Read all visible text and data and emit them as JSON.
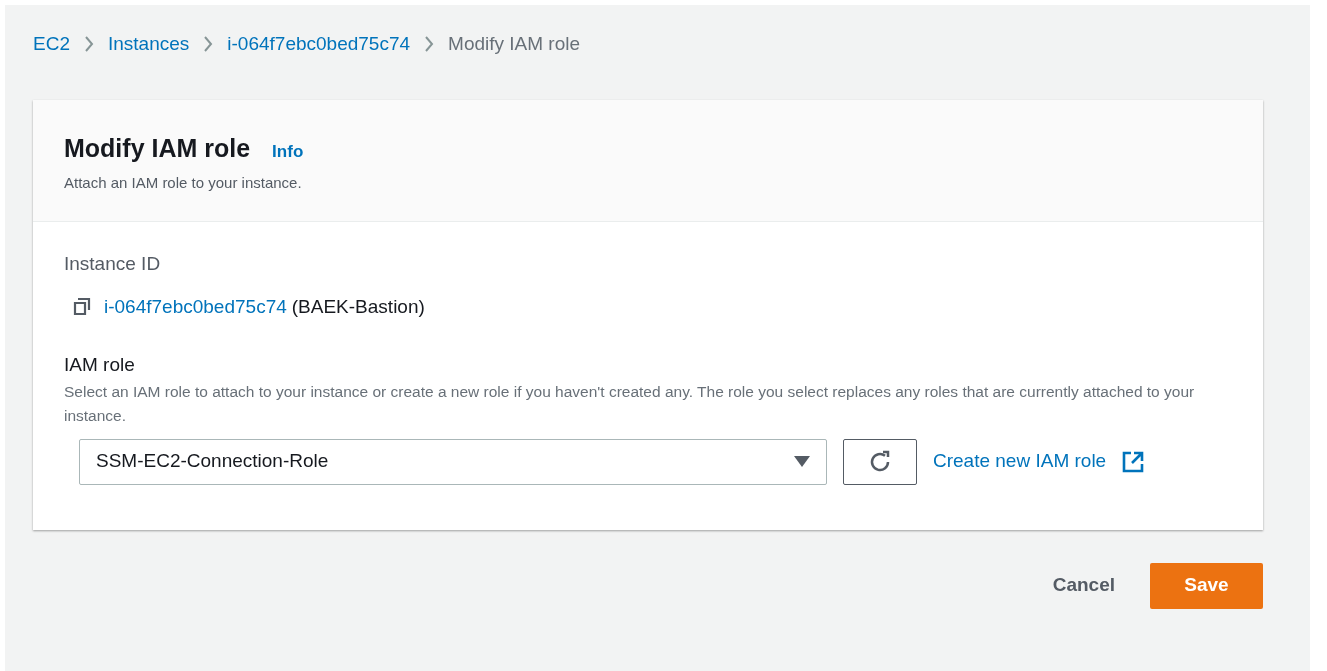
{
  "breadcrumbs": [
    {
      "label": "EC2",
      "kind": "link"
    },
    {
      "label": "Instances",
      "kind": "link"
    },
    {
      "label": "i-064f7ebc0bed75c74",
      "kind": "link"
    },
    {
      "label": "Modify IAM role",
      "kind": "current"
    }
  ],
  "panel": {
    "title": "Modify IAM role",
    "info": "Info",
    "description": "Attach an IAM role to your instance.",
    "instance": {
      "label": "Instance ID",
      "id": "i-064f7ebc0bed75c74",
      "name": "(BAEK-Bastion)"
    },
    "iam_role": {
      "label": "IAM role",
      "hint": "Select an IAM role to attach to your instance or create a new role if you haven't created any. The role you select replaces any roles that are currently attached to your instance.",
      "value": "SSM-EC2-Connection-Role",
      "create_link": "Create new IAM role"
    }
  },
  "buttons": {
    "cancel": "Cancel",
    "save": "Save"
  }
}
